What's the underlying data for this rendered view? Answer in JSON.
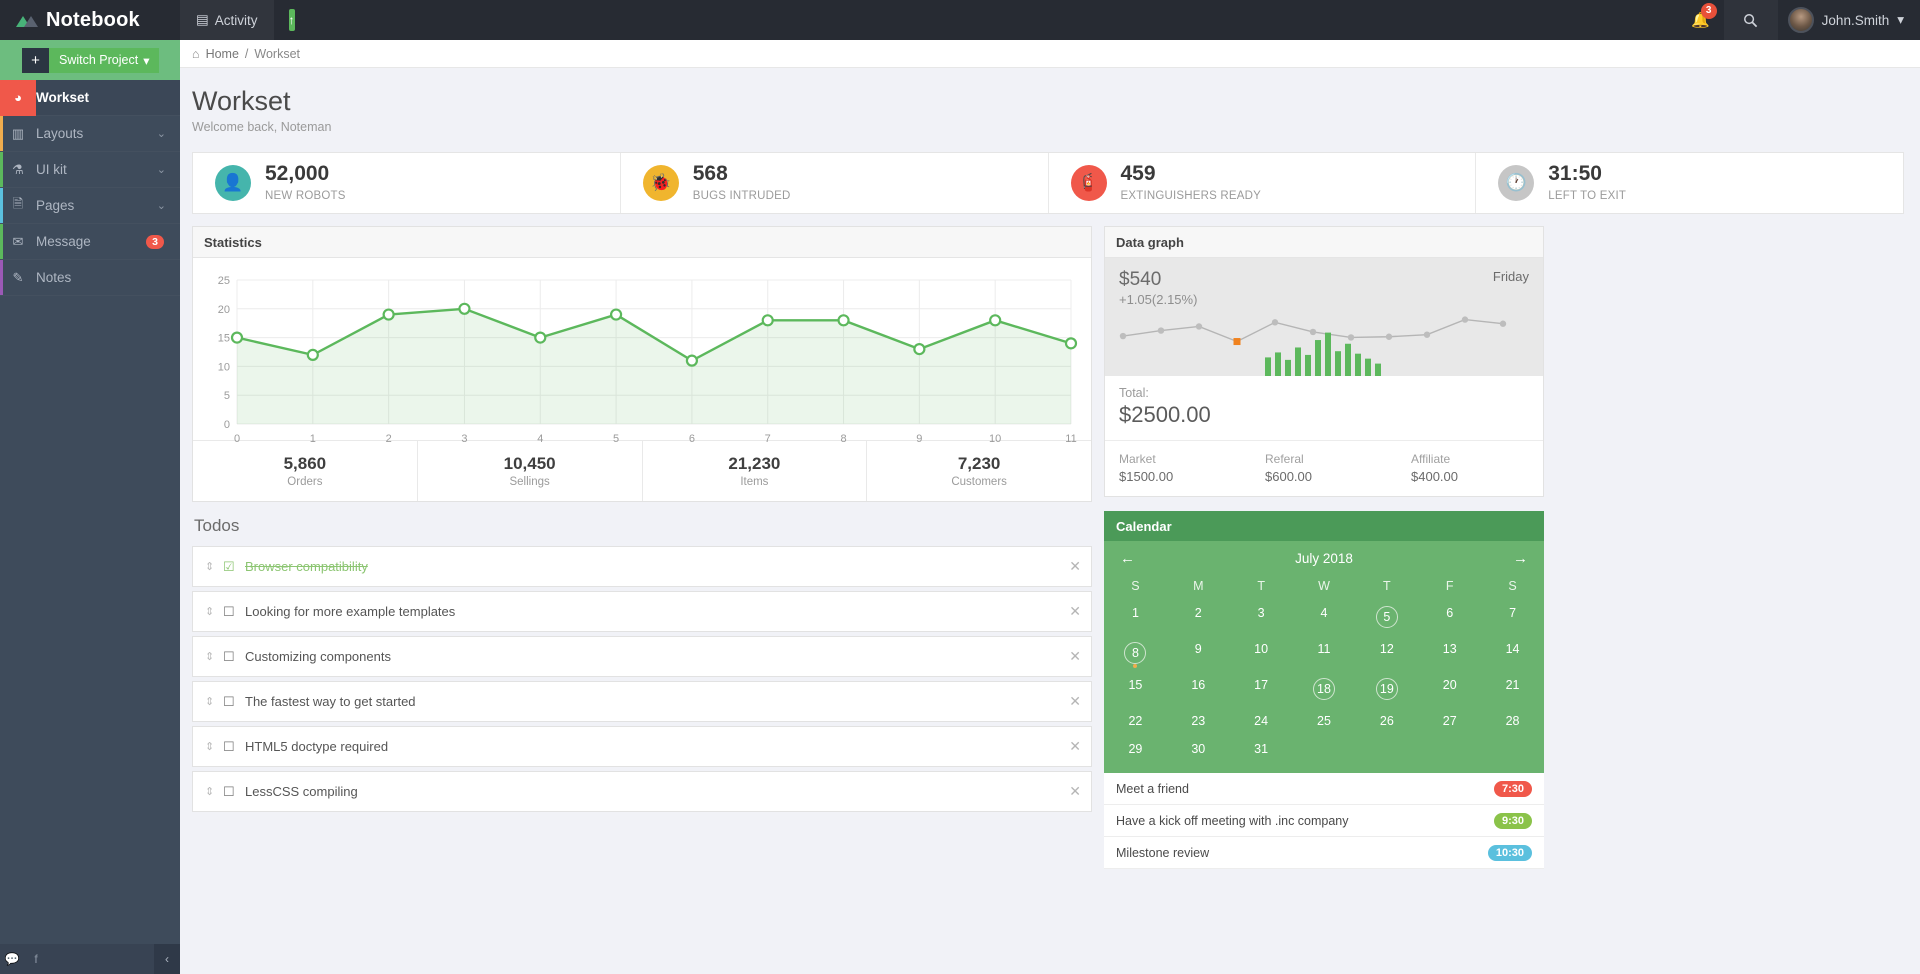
{
  "brand": {
    "name": "Notebook",
    "logo_icon": "triangles-logo"
  },
  "topnav": {
    "items": [
      {
        "label": "Activity",
        "icon": "building-icon",
        "active": true
      },
      {
        "label": "",
        "icon": "arrow-up-icon",
        "active": false
      }
    ],
    "notifications_count": "3",
    "search_icon": "search-icon",
    "user": {
      "name": "John.Smith",
      "caret": "▾"
    }
  },
  "sidebar": {
    "switch_project": {
      "plus": "+",
      "label": "Switch Project",
      "caret": "▾"
    },
    "items": [
      {
        "label": "Workset",
        "icon": "dashboard-icon",
        "active": true,
        "chevron": "",
        "badge": "",
        "accent": "#f0584a"
      },
      {
        "label": "Layouts",
        "icon": "columns-icon",
        "active": false,
        "chevron": "⌄",
        "badge": "",
        "accent": "#f0ad4e"
      },
      {
        "label": "UI kit",
        "icon": "flask-icon",
        "active": false,
        "chevron": "⌄",
        "badge": "",
        "accent": "#5cb85c"
      },
      {
        "label": "Pages",
        "icon": "file-icon",
        "active": false,
        "chevron": "⌄",
        "badge": "",
        "accent": "#5bc0de"
      },
      {
        "label": "Message",
        "icon": "envelope-icon",
        "active": false,
        "chevron": "",
        "badge": "3",
        "accent": "#5cb85c"
      },
      {
        "label": "Notes",
        "icon": "pencil-icon",
        "active": false,
        "chevron": "",
        "badge": "",
        "accent": "#9b59b6"
      }
    ],
    "footer": {
      "chat_icon": "chat-icon",
      "facebook_icon": "facebook-icon",
      "collapse_icon": "chevron-left-icon"
    }
  },
  "breadcrumb": {
    "home": "Home",
    "sep": "/",
    "current": "Workset",
    "home_icon": "home-icon"
  },
  "page": {
    "title": "Workset",
    "subtitle": "Welcome back, Noteman"
  },
  "kpis": [
    {
      "value": "52,000",
      "label": "NEW ROBOTS",
      "icon": "person-icon",
      "color": "#45b5ac"
    },
    {
      "value": "568",
      "label": "BUGS INTRUDED",
      "icon": "bug-icon",
      "color": "#f0b52e"
    },
    {
      "value": "459",
      "label": "EXTINGUISHERS READY",
      "icon": "extinguisher-icon",
      "color": "#f0584a"
    },
    {
      "value": "31:50",
      "label": "LEFT TO EXIT",
      "icon": "clock-icon",
      "color": "#c6c6c6"
    }
  ],
  "statistics": {
    "title": "Statistics",
    "footer": [
      {
        "value": "5,860",
        "label": "Orders"
      },
      {
        "value": "10,450",
        "label": "Sellings"
      },
      {
        "value": "21,230",
        "label": "Items"
      },
      {
        "value": "7,230",
        "label": "Customers"
      }
    ]
  },
  "chart_data": {
    "type": "area",
    "title": "Statistics",
    "xlabel": "",
    "ylabel": "",
    "x": [
      0,
      1,
      2,
      3,
      4,
      5,
      6,
      7,
      8,
      9,
      10,
      11
    ],
    "values": [
      15,
      12,
      19,
      20,
      15,
      19,
      11,
      18,
      18,
      13,
      18,
      14
    ],
    "categories": [
      "0",
      "1",
      "2",
      "3",
      "4",
      "5",
      "6",
      "7",
      "8",
      "9",
      "10",
      "11"
    ],
    "yticks": [
      0,
      5,
      10,
      15,
      20,
      25
    ],
    "ylim": [
      0,
      25
    ],
    "xlim": [
      0,
      11
    ],
    "grid": true,
    "legend": "none",
    "line_color": "#5cb85c",
    "fill_color": "rgba(92,184,92,0.12)"
  },
  "data_graph": {
    "title": "Data graph",
    "price": "$540",
    "delta": "+1.05(2.15%)",
    "day": "Friday",
    "total_label": "Total:",
    "total_value": "$2500.00",
    "breakdown": [
      {
        "label": "Market",
        "value": "$1500.00"
      },
      {
        "label": "Referal",
        "value": "$600.00"
      },
      {
        "label": "Affiliate",
        "value": "$400.00"
      }
    ],
    "sparkline": {
      "type": "line",
      "points": [
        32,
        40,
        46,
        24,
        52,
        38,
        30,
        31,
        34,
        56,
        50
      ],
      "highlight_index": 3,
      "highlight_color": "#f0821e",
      "line_color": "#b5b5b5",
      "bars": [
        30,
        38,
        26,
        46,
        34,
        58,
        70,
        40,
        52,
        36,
        28,
        20
      ],
      "bar_color": "#5cb85c"
    }
  },
  "todos": {
    "title": "Todos",
    "items": [
      {
        "text": "Browser compatibility",
        "done": true
      },
      {
        "text": "Looking for more example templates",
        "done": false
      },
      {
        "text": "Customizing components",
        "done": false
      },
      {
        "text": "The fastest way to get started",
        "done": false
      },
      {
        "text": "HTML5 doctype required",
        "done": false
      },
      {
        "text": "LessCSS compiling",
        "done": false
      }
    ],
    "remove_icon": "close-icon",
    "grip_icon": "drag-handle-icon"
  },
  "calendar": {
    "title": "Calendar",
    "month": "July 2018",
    "prev_icon": "arrow-left-icon",
    "next_icon": "arrow-right-icon",
    "dow": [
      "S",
      "M",
      "T",
      "W",
      "T",
      "F",
      "S"
    ],
    "days": [
      {
        "n": "1"
      },
      {
        "n": "2"
      },
      {
        "n": "3"
      },
      {
        "n": "4"
      },
      {
        "n": "5",
        "ring": true
      },
      {
        "n": "6"
      },
      {
        "n": "7"
      },
      {
        "n": "8",
        "ring": true,
        "dot": true
      },
      {
        "n": "9"
      },
      {
        "n": "10"
      },
      {
        "n": "11"
      },
      {
        "n": "12"
      },
      {
        "n": "13"
      },
      {
        "n": "14"
      },
      {
        "n": "15"
      },
      {
        "n": "16"
      },
      {
        "n": "17"
      },
      {
        "n": "18",
        "ring": true
      },
      {
        "n": "19",
        "ring": true
      },
      {
        "n": "20"
      },
      {
        "n": "21"
      },
      {
        "n": "22"
      },
      {
        "n": "23"
      },
      {
        "n": "24"
      },
      {
        "n": "25"
      },
      {
        "n": "26"
      },
      {
        "n": "27"
      },
      {
        "n": "28"
      },
      {
        "n": "29"
      },
      {
        "n": "30"
      },
      {
        "n": "31"
      }
    ],
    "events": [
      {
        "text": "Meet a friend",
        "time": "7:30",
        "color": "#f0584a"
      },
      {
        "text": "Have a kick off meeting with .inc company",
        "time": "9:30",
        "color": "#8bc34a"
      },
      {
        "text": "Milestone review",
        "time": "10:30",
        "color": "#5bc0de"
      }
    ]
  }
}
